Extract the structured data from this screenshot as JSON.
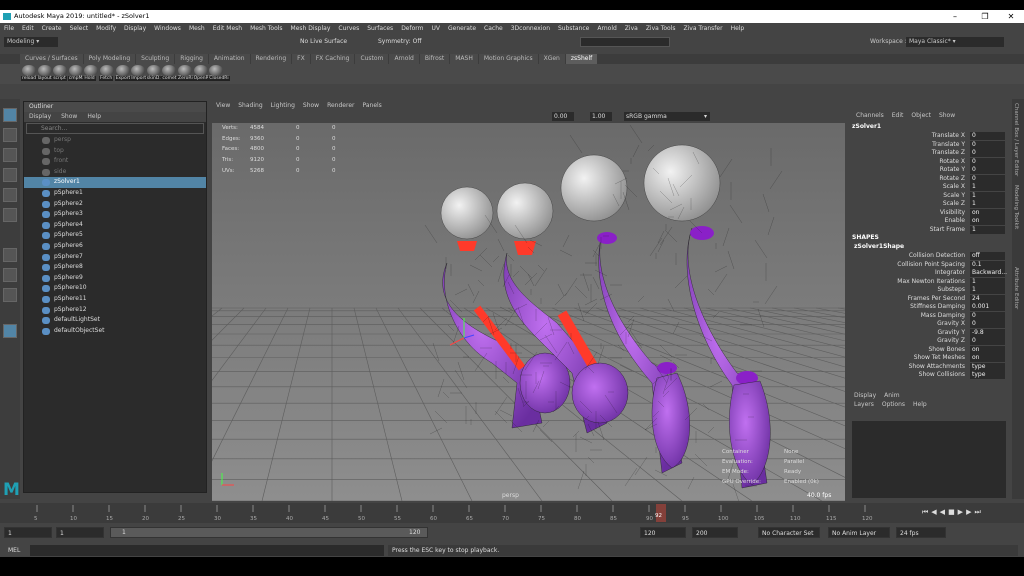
{
  "window": {
    "title": "Autodesk Maya 2019: untitled*    -    zSolver1"
  },
  "menubar": [
    "File",
    "Edit",
    "Create",
    "Select",
    "Modify",
    "Display",
    "Windows",
    "Mesh",
    "Edit Mesh",
    "Mesh Tools",
    "Mesh Display",
    "Curves",
    "Surfaces",
    "Deform",
    "UV",
    "Generate",
    "Cache",
    "3Dconnexion",
    "Substance",
    "Arnold",
    "Ziva",
    "Ziva Tools",
    "Ziva Transfer",
    "Help"
  ],
  "statusline": {
    "mode": "Modeling",
    "live_surface": "No Live Surface",
    "symmetry": "Symmetry: Off",
    "workspace_label": "Workspace :",
    "workspace": "Maya Classic*"
  },
  "shelf": {
    "tabs": [
      "Curves / Surfaces",
      "Poly Modeling",
      "Sculpting",
      "Rigging",
      "Animation",
      "Rendering",
      "FX",
      "FX Caching",
      "Custom",
      "Arnold",
      "Bifrost",
      "MASH",
      "Motion Graphics",
      "XGen",
      "zsShelf"
    ],
    "active": "zsShelf",
    "buttons": [
      "reload",
      "layout",
      "script",
      "cmpMa",
      "Hold",
      "Fetch",
      "Export",
      "Import",
      "skinD.t",
      "comet",
      "ZeroRig",
      "OpenRi",
      "ClosedRi"
    ]
  },
  "outliner": {
    "title": "Outliner",
    "menu": [
      "Display",
      "Show",
      "Help"
    ],
    "search_placeholder": "Search...",
    "items": [
      {
        "label": "persp",
        "state": "dim"
      },
      {
        "label": "top",
        "state": "dim"
      },
      {
        "label": "front",
        "state": "dim"
      },
      {
        "label": "side",
        "state": "dim"
      },
      {
        "label": "zSolver1",
        "state": "sel"
      },
      {
        "label": "pSphere1",
        "state": ""
      },
      {
        "label": "pSphere2",
        "state": ""
      },
      {
        "label": "pSphere3",
        "state": ""
      },
      {
        "label": "pSphere4",
        "state": ""
      },
      {
        "label": "pSphere5",
        "state": ""
      },
      {
        "label": "pSphere6",
        "state": ""
      },
      {
        "label": "pSphere7",
        "state": ""
      },
      {
        "label": "pSphere8",
        "state": ""
      },
      {
        "label": "pSphere9",
        "state": ""
      },
      {
        "label": "pSphere10",
        "state": ""
      },
      {
        "label": "pSphere11",
        "state": ""
      },
      {
        "label": "pSphere12",
        "state": ""
      },
      {
        "label": "defaultLightSet",
        "state": ""
      },
      {
        "label": "defaultObjectSet",
        "state": ""
      }
    ]
  },
  "viewport": {
    "menu": [
      "View",
      "Shading",
      "Lighting",
      "Show",
      "Renderer",
      "Panels"
    ],
    "exposure": "0.00",
    "gamma": "1.00",
    "colorspace": "sRGB gamma",
    "hud": [
      {
        "k": "Verts:",
        "v": "4584",
        "a": "0",
        "b": "0"
      },
      {
        "k": "Edges:",
        "v": "9360",
        "a": "0",
        "b": "0"
      },
      {
        "k": "Faces:",
        "v": "4800",
        "a": "0",
        "b": "0"
      },
      {
        "k": "Tris:",
        "v": "9120",
        "a": "0",
        "b": "0"
      },
      {
        "k": "UVs:",
        "v": "5268",
        "a": "0",
        "b": "0"
      }
    ],
    "hud2": [
      {
        "k": "Container",
        "v": "None"
      },
      {
        "k": "Evaluation:",
        "v": "Parallel"
      },
      {
        "k": "EM Mode:",
        "v": "Ready"
      },
      {
        "k": "GPU Override:",
        "v": "Enabled (0k)"
      }
    ],
    "camera": "persp",
    "fps": "40.0 fps"
  },
  "channels": {
    "menu": [
      "Channels",
      "Edit",
      "Object",
      "Show"
    ],
    "node": "zSolver1",
    "transform": [
      {
        "l": "Translate X",
        "v": "0"
      },
      {
        "l": "Translate Y",
        "v": "0"
      },
      {
        "l": "Translate Z",
        "v": "0"
      },
      {
        "l": "Rotate X",
        "v": "0"
      },
      {
        "l": "Rotate Y",
        "v": "0"
      },
      {
        "l": "Rotate Z",
        "v": "0"
      },
      {
        "l": "Scale X",
        "v": "1"
      },
      {
        "l": "Scale Y",
        "v": "1"
      },
      {
        "l": "Scale Z",
        "v": "1"
      },
      {
        "l": "Visibility",
        "v": "on"
      },
      {
        "l": "Enable",
        "v": "on"
      },
      {
        "l": "Start Frame",
        "v": "1"
      }
    ],
    "shapes_label": "SHAPES",
    "shape_node": "zSolver1Shape",
    "shape": [
      {
        "l": "Collision Detection",
        "v": "off"
      },
      {
        "l": "Collision Point Spacing",
        "v": "0.1"
      },
      {
        "l": "Integrator",
        "v": "Backward..."
      },
      {
        "l": "Max Newton Iterations",
        "v": "1"
      },
      {
        "l": "Substeps",
        "v": "1"
      },
      {
        "l": "Frames Per Second",
        "v": "24"
      },
      {
        "l": "Stiffness Damping",
        "v": "0.001"
      },
      {
        "l": "Mass Damping",
        "v": "0"
      },
      {
        "l": "Gravity X",
        "v": "0"
      },
      {
        "l": "Gravity Y",
        "v": "-9.8"
      },
      {
        "l": "Gravity Z",
        "v": "0"
      },
      {
        "l": "Show Bones",
        "v": "on"
      },
      {
        "l": "Show Tet Meshes",
        "v": "on"
      },
      {
        "l": "Show Attachments",
        "v": "type"
      },
      {
        "l": "Show Collisions",
        "v": "type"
      }
    ]
  },
  "layer_editor": {
    "tabs": [
      "Display",
      "Anim"
    ],
    "menu": [
      "Layers",
      "Options",
      "Help"
    ]
  },
  "sidetabs": [
    "Channel Box / Layer Editor",
    "Modeling Toolkit",
    "Attribute Editor"
  ],
  "timeline": {
    "ticks": [
      "5",
      "10",
      "15",
      "20",
      "25",
      "30",
      "35",
      "40",
      "45",
      "50",
      "55",
      "60",
      "65",
      "70",
      "75",
      "80",
      "85",
      "90",
      "95",
      "100",
      "105",
      "110",
      "115",
      "120"
    ],
    "current_frame": "92"
  },
  "range": {
    "start": "1",
    "anim_start": "1",
    "slider_start": "1",
    "slider_end": "120",
    "end": "120",
    "anim_end": "200",
    "character": "No Character Set",
    "anim_layer": "No Anim Layer",
    "fps": "24 fps"
  },
  "command": {
    "lang": "MEL",
    "help": "Press the ESC key to stop playback."
  }
}
